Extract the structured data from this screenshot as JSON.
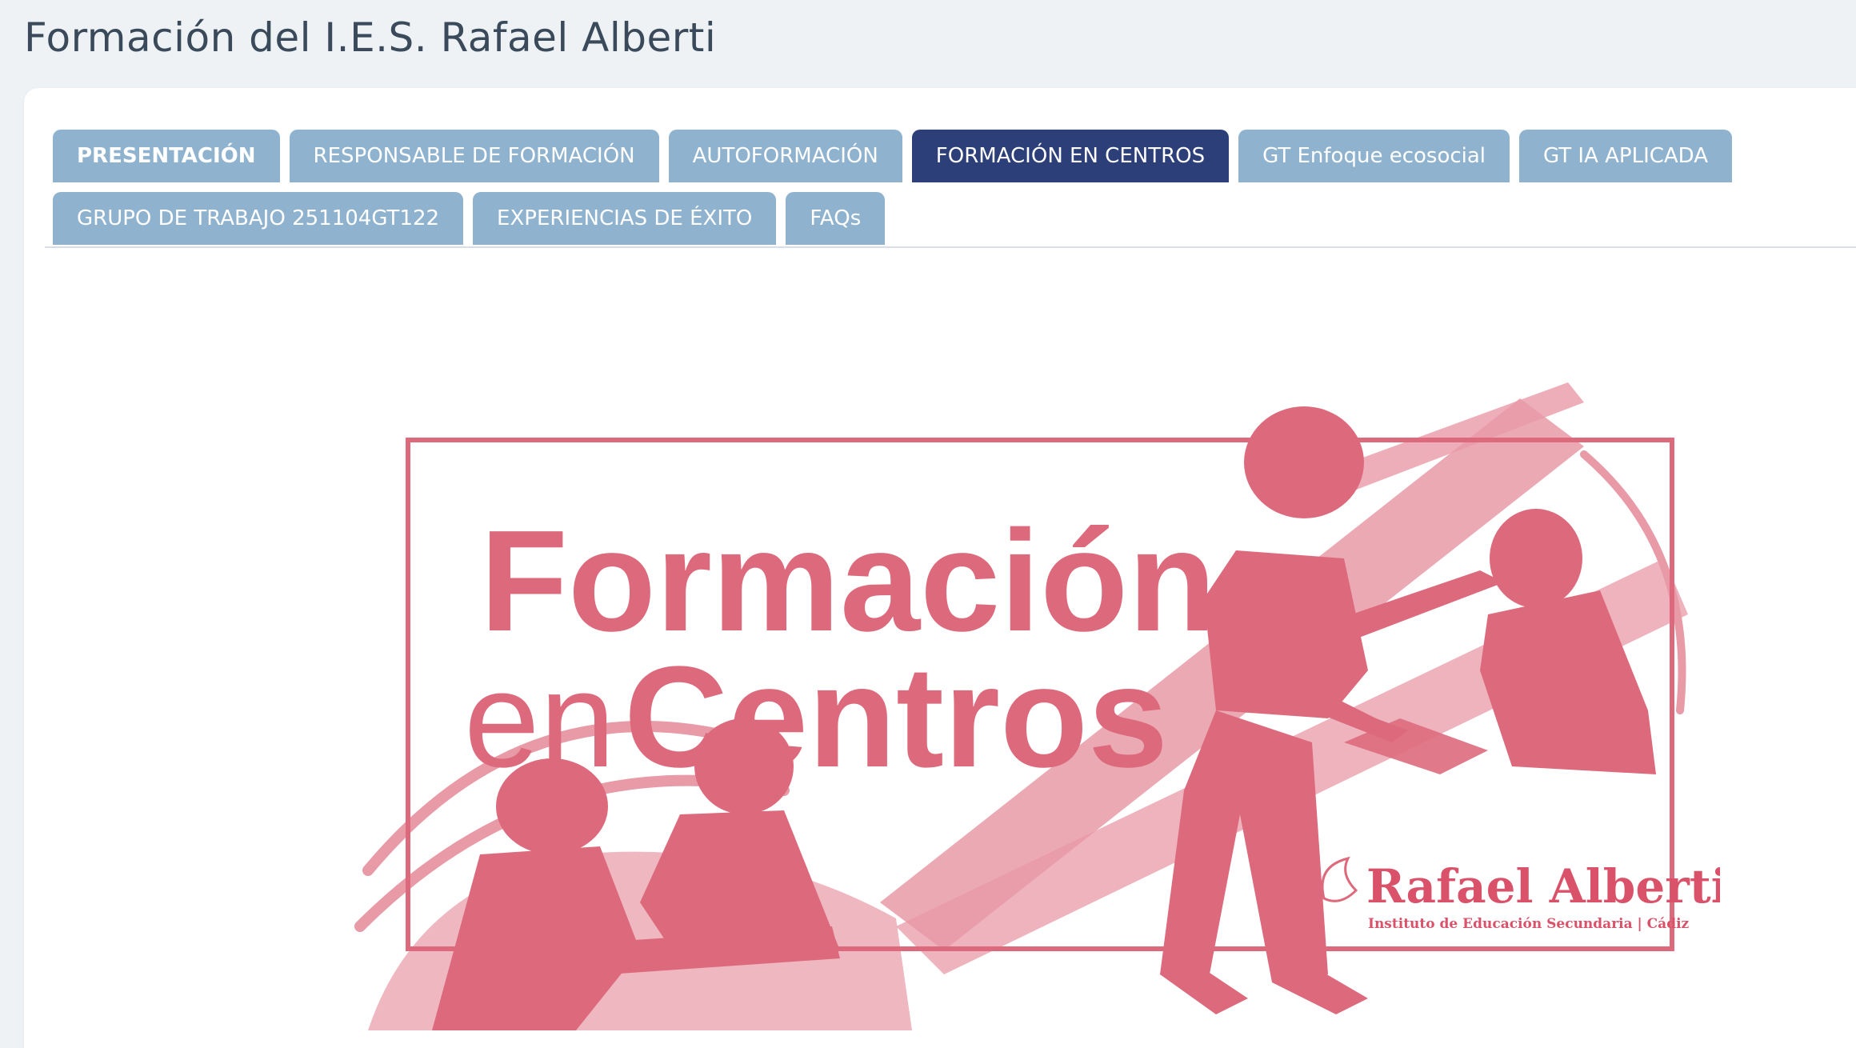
{
  "page": {
    "title": "Formación del I.E.S. Rafael Alberti"
  },
  "tabs": {
    "row1": [
      {
        "label": "PRESENTACIÓN"
      },
      {
        "label": "RESPONSABLE DE FORMACIÓN"
      },
      {
        "label": "AUTOFORMACIÓN"
      },
      {
        "label": "FORMACIÓN EN CENTROS"
      },
      {
        "label": "GT Enfoque ecosocial"
      },
      {
        "label": "GT IA APLICADA"
      }
    ],
    "row2": [
      {
        "label": "GRUPO DE TRABAJO 251104GT122"
      },
      {
        "label": "EXPERIENCIAS DE ÉXITO"
      },
      {
        "label": "FAQs"
      }
    ],
    "active": "FORMACIÓN EN CENTROS"
  },
  "banner": {
    "title_line1": "Formación",
    "title_line2_light": "en",
    "title_line2_bold": "Centros",
    "logo_name": "Rafael Alberti",
    "logo_subtitle": "Instituto de Educación Secundaria | Cádiz",
    "illustration": "people-collaborating-illustration"
  },
  "colors": {
    "tab_bg": "#8fb3cf",
    "tab_active_bg": "#2c3f78",
    "brand_pink": "#dd6a7c",
    "brand_pink_light": "#e89aa7"
  }
}
